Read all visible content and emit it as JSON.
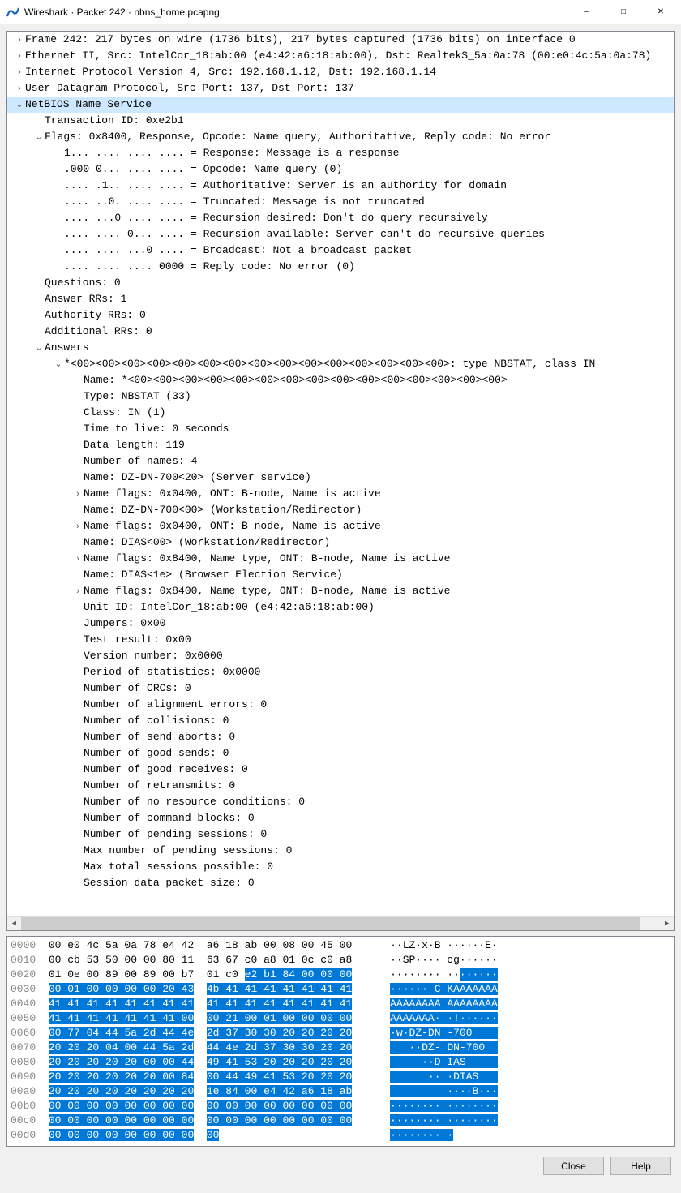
{
  "window": {
    "title": "Wireshark · Packet 242 · nbns_home.pcapng"
  },
  "buttons": {
    "close": "Close",
    "help": "Help"
  },
  "tree": [
    {
      "exp": ">",
      "indent": 0,
      "text": "Frame 242: 217 bytes on wire (1736 bits), 217 bytes captured (1736 bits) on interface 0"
    },
    {
      "exp": ">",
      "indent": 0,
      "text": "Ethernet II, Src: IntelCor_18:ab:00 (e4:42:a6:18:ab:00), Dst: RealtekS_5a:0a:78 (00:e0:4c:5a:0a:78)"
    },
    {
      "exp": ">",
      "indent": 0,
      "text": "Internet Protocol Version 4, Src: 192.168.1.12, Dst: 192.168.1.14"
    },
    {
      "exp": ">",
      "indent": 0,
      "text": "User Datagram Protocol, Src Port: 137, Dst Port: 137"
    },
    {
      "exp": "v",
      "indent": 0,
      "text": "NetBIOS Name Service",
      "selected": true
    },
    {
      "exp": " ",
      "indent": 1,
      "text": "Transaction ID: 0xe2b1"
    },
    {
      "exp": "v",
      "indent": 1,
      "text": "Flags: 0x8400, Response, Opcode: Name query, Authoritative, Reply code: No error"
    },
    {
      "exp": " ",
      "indent": 2,
      "text": "1... .... .... .... = Response: Message is a response"
    },
    {
      "exp": " ",
      "indent": 2,
      "text": ".000 0... .... .... = Opcode: Name query (0)"
    },
    {
      "exp": " ",
      "indent": 2,
      "text": ".... .1.. .... .... = Authoritative: Server is an authority for domain"
    },
    {
      "exp": " ",
      "indent": 2,
      "text": ".... ..0. .... .... = Truncated: Message is not truncated"
    },
    {
      "exp": " ",
      "indent": 2,
      "text": ".... ...0 .... .... = Recursion desired: Don't do query recursively"
    },
    {
      "exp": " ",
      "indent": 2,
      "text": ".... .... 0... .... = Recursion available: Server can't do recursive queries"
    },
    {
      "exp": " ",
      "indent": 2,
      "text": ".... .... ...0 .... = Broadcast: Not a broadcast packet"
    },
    {
      "exp": " ",
      "indent": 2,
      "text": ".... .... .... 0000 = Reply code: No error (0)"
    },
    {
      "exp": " ",
      "indent": 1,
      "text": "Questions: 0"
    },
    {
      "exp": " ",
      "indent": 1,
      "text": "Answer RRs: 1"
    },
    {
      "exp": " ",
      "indent": 1,
      "text": "Authority RRs: 0"
    },
    {
      "exp": " ",
      "indent": 1,
      "text": "Additional RRs: 0"
    },
    {
      "exp": "v",
      "indent": 1,
      "text": "Answers"
    },
    {
      "exp": "v",
      "indent": 2,
      "text": "*<00><00><00><00><00><00><00><00><00><00><00><00><00><00><00>: type NBSTAT, class IN"
    },
    {
      "exp": " ",
      "indent": 3,
      "text": "Name: *<00><00><00><00><00><00><00><00><00><00><00><00><00><00><00>"
    },
    {
      "exp": " ",
      "indent": 3,
      "text": "Type: NBSTAT (33)"
    },
    {
      "exp": " ",
      "indent": 3,
      "text": "Class: IN (1)"
    },
    {
      "exp": " ",
      "indent": 3,
      "text": "Time to live: 0 seconds"
    },
    {
      "exp": " ",
      "indent": 3,
      "text": "Data length: 119"
    },
    {
      "exp": " ",
      "indent": 3,
      "text": "Number of names: 4"
    },
    {
      "exp": " ",
      "indent": 3,
      "text": "Name: DZ-DN-700<20> (Server service)"
    },
    {
      "exp": ">",
      "indent": 3,
      "text": "Name flags: 0x0400, ONT: B-node, Name is active"
    },
    {
      "exp": " ",
      "indent": 3,
      "text": "Name: DZ-DN-700<00> (Workstation/Redirector)"
    },
    {
      "exp": ">",
      "indent": 3,
      "text": "Name flags: 0x0400, ONT: B-node, Name is active"
    },
    {
      "exp": " ",
      "indent": 3,
      "text": "Name: DIAS<00> (Workstation/Redirector)"
    },
    {
      "exp": ">",
      "indent": 3,
      "text": "Name flags: 0x8400, Name type, ONT: B-node, Name is active"
    },
    {
      "exp": " ",
      "indent": 3,
      "text": "Name: DIAS<1e> (Browser Election Service)"
    },
    {
      "exp": ">",
      "indent": 3,
      "text": "Name flags: 0x8400, Name type, ONT: B-node, Name is active"
    },
    {
      "exp": " ",
      "indent": 3,
      "text": "Unit ID: IntelCor_18:ab:00 (e4:42:a6:18:ab:00)"
    },
    {
      "exp": " ",
      "indent": 3,
      "text": "Jumpers: 0x00"
    },
    {
      "exp": " ",
      "indent": 3,
      "text": "Test result: 0x00"
    },
    {
      "exp": " ",
      "indent": 3,
      "text": "Version number: 0x0000"
    },
    {
      "exp": " ",
      "indent": 3,
      "text": "Period of statistics: 0x0000"
    },
    {
      "exp": " ",
      "indent": 3,
      "text": "Number of CRCs: 0"
    },
    {
      "exp": " ",
      "indent": 3,
      "text": "Number of alignment errors: 0"
    },
    {
      "exp": " ",
      "indent": 3,
      "text": "Number of collisions: 0"
    },
    {
      "exp": " ",
      "indent": 3,
      "text": "Number of send aborts: 0"
    },
    {
      "exp": " ",
      "indent": 3,
      "text": "Number of good sends: 0"
    },
    {
      "exp": " ",
      "indent": 3,
      "text": "Number of good receives: 0"
    },
    {
      "exp": " ",
      "indent": 3,
      "text": "Number of retransmits: 0"
    },
    {
      "exp": " ",
      "indent": 3,
      "text": "Number of no resource conditions: 0"
    },
    {
      "exp": " ",
      "indent": 3,
      "text": "Number of command blocks: 0"
    },
    {
      "exp": " ",
      "indent": 3,
      "text": "Number of pending sessions: 0"
    },
    {
      "exp": " ",
      "indent": 3,
      "text": "Max number of pending sessions: 0"
    },
    {
      "exp": " ",
      "indent": 3,
      "text": "Max total sessions possible: 0"
    },
    {
      "exp": " ",
      "indent": 3,
      "text": "Session data packet size: 0"
    }
  ],
  "hex": [
    {
      "off": "0000",
      "h1": "00 e0 4c 5a 0a 78 e4 42",
      "h2": "a6 18 ab 00 08 00 45 00",
      "a1": "··LZ·x·B",
      "a2": " ······E·"
    },
    {
      "off": "0010",
      "h1": "00 cb 53 50 00 00 80 11",
      "h2": "63 67 c0 a8 01 0c c0 a8",
      "a1": "··SP····",
      "a2": " cg······"
    },
    {
      "off": "0020",
      "h1": "01 0e 00 89 00 89 00 b7",
      "h2": "01 c0 ",
      "h2b": "e2 b1 84 00 00 00",
      "a1": "········",
      "a2": " ··",
      "a2b": "······"
    },
    {
      "off": "0030",
      "h1b": "00 01 00 00 00 00 20 43",
      "h2b": "4b 41 41 41 41 41 41 41",
      "a1b": "······ C",
      "a2b": " KAAAAAAA"
    },
    {
      "off": "0040",
      "h1b": "41 41 41 41 41 41 41 41",
      "h2b": "41 41 41 41 41 41 41 41",
      "a1b": "AAAAAAAA",
      "a2b": " AAAAAAAA"
    },
    {
      "off": "0050",
      "h1b": "41 41 41 41 41 41 41 00",
      "h2b": "00 21 00 01 00 00 00 00",
      "a1b": "AAAAAAA·",
      "a2b": " ·!······"
    },
    {
      "off": "0060",
      "h1b": "00 77 04 44 5a 2d 44 4e",
      "h2b": "2d 37 30 30 20 20 20 20",
      "a1b": "·w·DZ-DN",
      "a2b": " -700    "
    },
    {
      "off": "0070",
      "h1b": "20 20 20 04 00 44 5a 2d",
      "h2b": "44 4e 2d 37 30 30 20 20",
      "a1b": "   ··DZ-",
      "a2b": " DN-700  "
    },
    {
      "off": "0080",
      "h1b": "20 20 20 20 20 00 00 44",
      "h2b": "49 41 53 20 20 20 20 20",
      "a1b": "     ··D",
      "a2b": " IAS     "
    },
    {
      "off": "0090",
      "h1b": "20 20 20 20 20 20 00 84",
      "h2b": "00 44 49 41 53 20 20 20",
      "a1b": "      ··",
      "a2b": " ·DIAS   "
    },
    {
      "off": "00a0",
      "h1b": "20 20 20 20 20 20 20 20",
      "h2b": "1e 84 00 e4 42 a6 18 ab",
      "a1b": "        ",
      "a2b": " ····B···"
    },
    {
      "off": "00b0",
      "h1b": "00 00 00 00 00 00 00 00",
      "h2b": "00 00 00 00 00 00 00 00",
      "a1b": "········",
      "a2b": " ········"
    },
    {
      "off": "00c0",
      "h1b": "00 00 00 00 00 00 00 00",
      "h2b": "00 00 00 00 00 00 00 00",
      "a1b": "········",
      "a2b": " ········"
    },
    {
      "off": "00d0",
      "h1b": "00 00 00 00 00 00 00 00",
      "h2b": "00",
      "a1b": "········",
      "a2b": " ·"
    }
  ]
}
